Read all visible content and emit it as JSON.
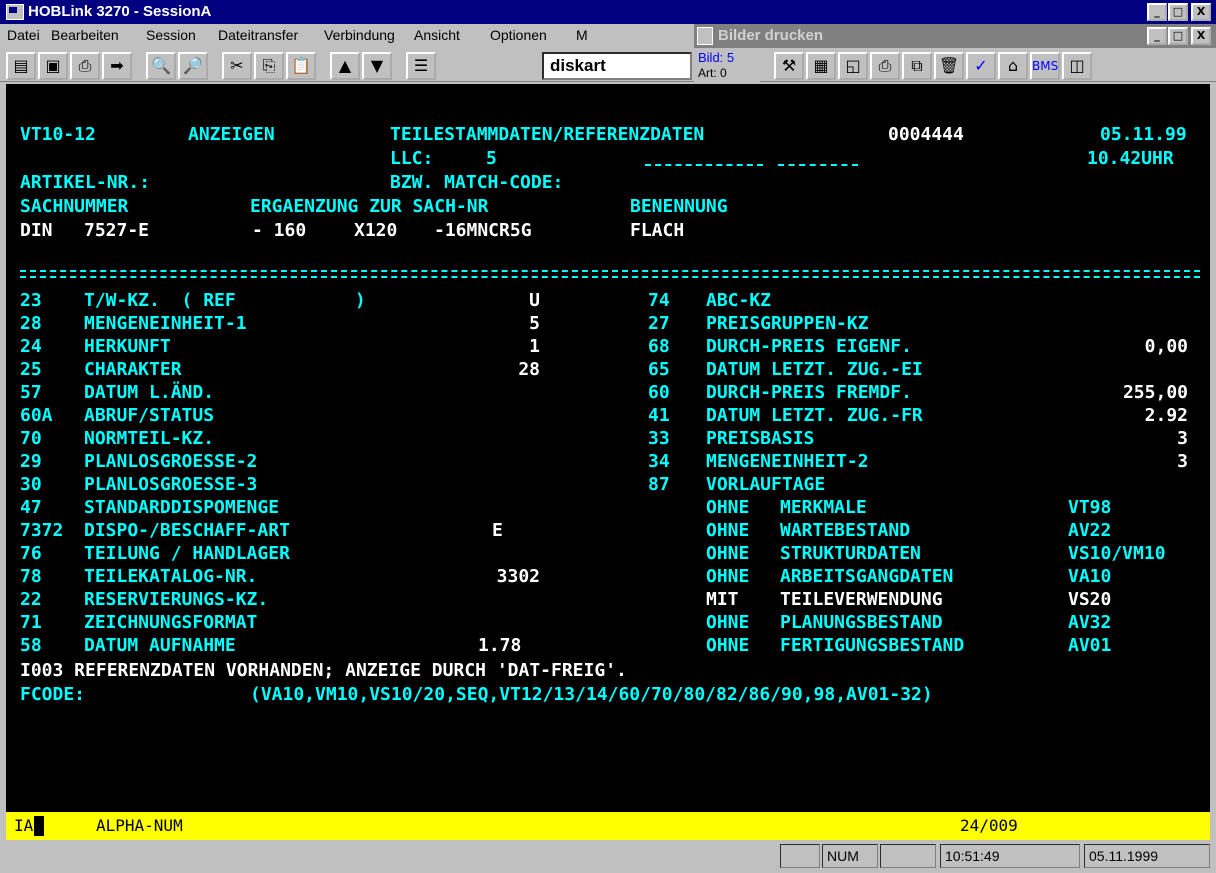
{
  "window": {
    "title": "HOBLink 3270 - SessionA",
    "controls": [
      "_",
      "□",
      "X"
    ]
  },
  "menu": {
    "items": [
      "Datei",
      "Bearbeiten",
      "Session",
      "Dateitransfer",
      "Verbindung",
      "Ansicht",
      "Optionen",
      "M"
    ]
  },
  "print_window": {
    "title": "Bilder drucken",
    "controls": [
      "_",
      "□",
      "X"
    ],
    "bild_label": "Bild: 5",
    "art_label": "Art: 0"
  },
  "toolbar": {
    "combo_value": "diskart"
  },
  "screen": {
    "header": {
      "code": "VT10-12",
      "mode": "ANZEIGEN",
      "title": "TEILESTAMMDATEN/REFERENZDATEN",
      "number": "0004444",
      "date": "05.11.99",
      "llc_label": "LLC:",
      "llc_value": "5",
      "time": "10.42UHR",
      "artikel_label": "ARTIKEL-NR.:",
      "match_label": "BZW. MATCH-CODE:",
      "col_sachnummer": "SACHNUMMER",
      "col_ergaenzung": "ERGAENZUNG ZUR SACH-NR",
      "col_benennung": "BENENNUNG",
      "sach_a": "DIN",
      "sach_b": "7527-E",
      "erg_a": "- 160",
      "erg_b": "X120",
      "erg_c": "-16MNCR5G",
      "benennung": "FLACH"
    },
    "left_rows": [
      {
        "code": "23",
        "label": "T/W-KZ.  ( REF           )",
        "value": "U"
      },
      {
        "code": "28",
        "label": "MENGENEINHEIT-1",
        "value": "5"
      },
      {
        "code": "24",
        "label": "HERKUNFT",
        "value": "1"
      },
      {
        "code": "25",
        "label": "CHARAKTER",
        "value": "28"
      },
      {
        "code": "57",
        "label": "DATUM L.ÄND.",
        "value": ""
      },
      {
        "code": "60A",
        "label": "ABRUF/STATUS",
        "value": ""
      },
      {
        "code": "70",
        "label": "NORMTEIL-KZ.",
        "value": ""
      },
      {
        "code": "29",
        "label": "PLANLOSGROESSE-2",
        "value": ""
      },
      {
        "code": "30",
        "label": "PLANLOSGROESSE-3",
        "value": ""
      },
      {
        "code": "47",
        "label": "STANDARDDISPOMENGE",
        "value": ""
      },
      {
        "code": "7372",
        "label": "DISPO-/BESCHAFF-ART",
        "value": "E"
      },
      {
        "code": "76",
        "label": "TEILUNG / HANDLAGER",
        "value": ""
      },
      {
        "code": "78",
        "label": "TEILEKATALOG-NR.",
        "value": "3302"
      },
      {
        "code": "22",
        "label": "RESERVIERUNGS-KZ.",
        "value": ""
      },
      {
        "code": "71",
        "label": "ZEICHNUNGSFORMAT",
        "value": ""
      },
      {
        "code": "58",
        "label": "DATUM AUFNAHME",
        "value": "1.78"
      }
    ],
    "right_rows": [
      {
        "code": "74",
        "label": "ABC-KZ",
        "value": ""
      },
      {
        "code": "27",
        "label": "PREISGRUPPEN-KZ",
        "value": ""
      },
      {
        "code": "68",
        "label": "DURCH-PREIS EIGENF.",
        "value": "0,00"
      },
      {
        "code": "65",
        "label": "DATUM LETZT. ZUG.-EI",
        "value": ""
      },
      {
        "code": "60",
        "label": "DURCH-PREIS FREMDF.",
        "value": "255,00"
      },
      {
        "code": "41",
        "label": "DATUM LETZT. ZUG.-FR",
        "value": "2.92"
      },
      {
        "code": "33",
        "label": "PREISBASIS",
        "value": "3"
      },
      {
        "code": "34",
        "label": "MENGENEINHEIT-2",
        "value": "3"
      },
      {
        "code": "87",
        "label": "VORLAUFTAGE",
        "value": ""
      }
    ],
    "links": [
      {
        "prefix": "OHNE",
        "label": "MERKMALE",
        "code": "VT98"
      },
      {
        "prefix": "OHNE",
        "label": "WARTEBESTAND",
        "code": "AV22"
      },
      {
        "prefix": "OHNE",
        "label": "STRUKTURDATEN",
        "code": "VS10/VM10"
      },
      {
        "prefix": "OHNE",
        "label": "ARBEITSGANGDATEN",
        "code": "VA10"
      },
      {
        "prefix": "MIT",
        "label": "TEILEVERWENDUNG",
        "code": "VS20"
      },
      {
        "prefix": "OHNE",
        "label": "PLANUNGSBESTAND",
        "code": "AV32"
      },
      {
        "prefix": "OHNE",
        "label": "FERTIGUNGSBESTAND",
        "code": "AV01"
      }
    ],
    "message": "I003 REFERENZDATEN VORHANDEN; ANZEIGE DURCH 'DAT-FREIG'.",
    "fcode_label": "FCODE:",
    "fcode_options": "(VA10,VM10,VS10/20,SEQ,VT12/13/14/60/70/80/82/86/90,98,AV01-32)"
  },
  "oia": {
    "indicator": "IA",
    "mode": "ALPHA-NUM",
    "cursor": "24/009"
  },
  "statusbar": {
    "num": "NUM",
    "time": "10:51:49",
    "date": "05.11.1999"
  },
  "colors": {
    "terminal_bg": "#000000",
    "field_cyan": "#00ffff",
    "field_white": "#ffffff",
    "oia_yellow": "#ffff00",
    "title_blue": "#000080"
  }
}
